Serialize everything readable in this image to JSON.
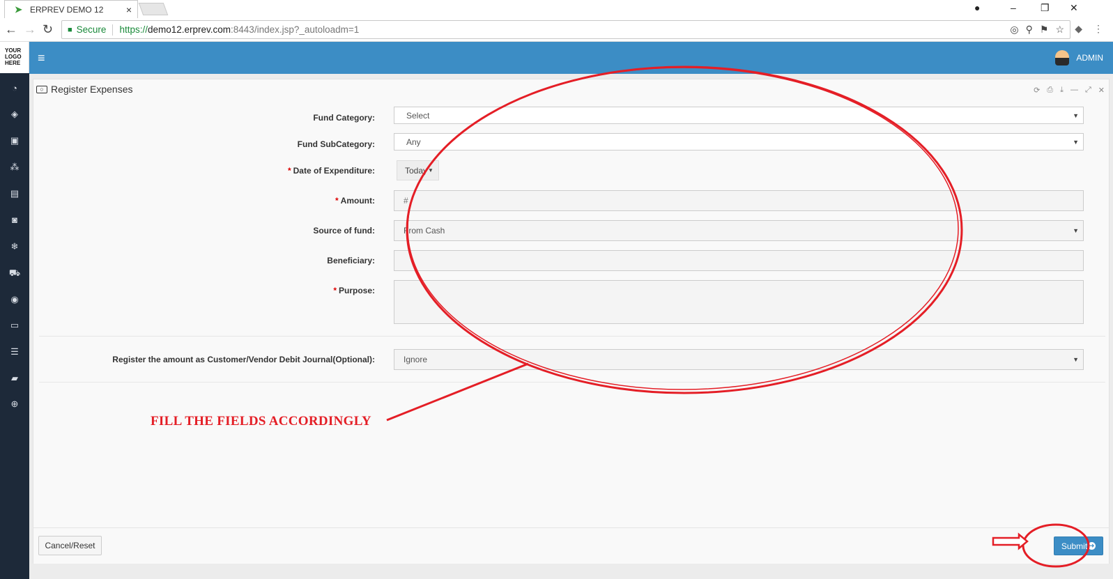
{
  "browser": {
    "tab_title": "ERPREV DEMO 12",
    "tab_close": "×",
    "secure_label": "Secure",
    "url_scheme": "https://",
    "url_host": "demo12.erprev.com",
    "url_rest": ":8443/index.jsp?_autoloadm=1"
  },
  "app": {
    "logo_text": "YOUR LOGO HERE",
    "user_name": "ADMIN",
    "panel_title": "Register Expenses"
  },
  "form": {
    "fund_category": {
      "label": "Fund Category:",
      "value": "Select"
    },
    "fund_subcategory": {
      "label": "Fund SubCategory:",
      "value": "Any"
    },
    "date_of_expenditure": {
      "label": "Date of Expenditure:",
      "value": "Today"
    },
    "amount": {
      "label": "Amount:",
      "placeholder": "#"
    },
    "source_of_fund": {
      "label": "Source of fund:",
      "value": "From Cash"
    },
    "beneficiary": {
      "label": "Beneficiary:",
      "value": ""
    },
    "purpose": {
      "label": "Purpose:",
      "value": ""
    },
    "debit_journal": {
      "label": "Register the amount as Customer/Vendor Debit Journal(Optional):",
      "value": "Ignore"
    },
    "required_marker": "*"
  },
  "actions": {
    "cancel_label": "Cancel/Reset",
    "submit_label": "Submit"
  },
  "annotation": {
    "text": "FILL THE FIELDS ACCORDINGLY",
    "color": "#e41e26"
  },
  "colors": {
    "header": "#3c8dc5",
    "sidebar": "#1d2939",
    "submit": "#3c8dc5"
  }
}
